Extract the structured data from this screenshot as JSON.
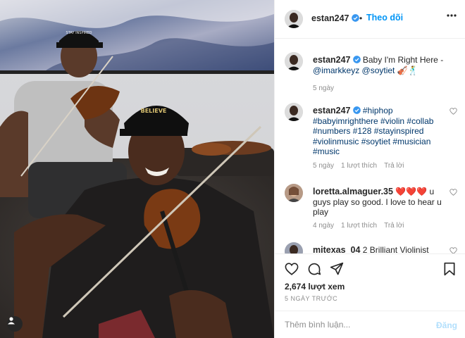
{
  "post": {
    "author": "estan247",
    "follow_label": "Theo dõi",
    "caption_text": "Baby I'm Right Here -",
    "caption_mentions": "@imarkkeyz @soytiet",
    "caption_emoji": "🎻🕺",
    "caption_age": "5 ngày",
    "views": "2,674 lượt xem",
    "posted": "5 NGÀY TRƯỚC"
  },
  "comments": [
    {
      "user": "estan247",
      "text": "#hiphop #babyimrighthere #violin #collab #numbers #128 #stayinspired #violinmusic #soytiet #musician #music",
      "age": "5 ngày",
      "likes": "1 lượt thích",
      "reply": "Trả lời"
    },
    {
      "user": "loretta.almaguer.35",
      "text_emoji": "❤️❤️❤️",
      "text": "u guys play so good. I love to hear u play",
      "age": "4 ngày",
      "likes": "1 lượt thích",
      "reply": "Trả lời"
    },
    {
      "user": "mitexas_04",
      "text": "2 Brilliant Violinist"
    }
  ],
  "composer": {
    "placeholder": "Thêm bình luận...",
    "post_label": "Đăng"
  },
  "icons": {
    "verified": "verified-badge-icon",
    "more": "more-horizontal-icon",
    "like": "heart-icon",
    "comment": "comment-icon",
    "share": "paper-plane-icon",
    "save": "bookmark-icon",
    "user_tag": "user-icon"
  },
  "colors": {
    "link": "#00376b",
    "accent": "#0095f6",
    "muted": "#8e8e8e",
    "post_disabled": "#b2dffc"
  },
  "media": {
    "cap_front": "BELIEVE",
    "cap_back": "STAY INSPIRED"
  }
}
